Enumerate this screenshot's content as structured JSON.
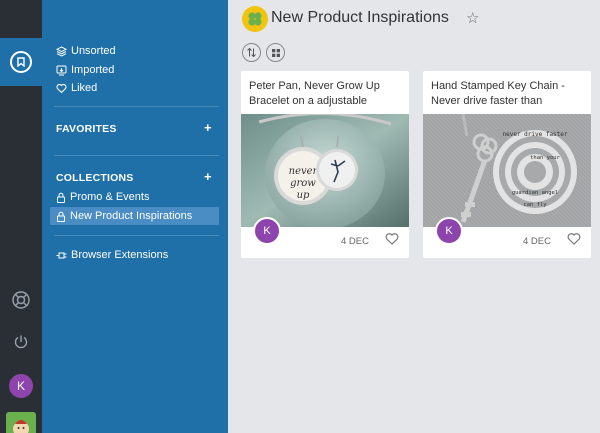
{
  "rail": {
    "avatar_initial": "K"
  },
  "sidebar": {
    "items": [
      {
        "label": "Unsorted",
        "icon": "layers-icon"
      },
      {
        "label": "Imported",
        "icon": "import-icon"
      },
      {
        "label": "Liked",
        "icon": "heart-icon"
      }
    ],
    "favorites_title": "FAVORITES",
    "favorites_add": "+",
    "collections_title": "COLLECTIONS",
    "collections_add": "+",
    "collections": [
      {
        "label": "Promo & Events",
        "icon": "lock-icon"
      },
      {
        "label": "New Product Inspirations",
        "icon": "lock-icon",
        "active": true
      }
    ],
    "extensions_label": "Browser Extensions"
  },
  "main": {
    "title": "New Product Inspirations",
    "star": "☆"
  },
  "cards": [
    {
      "title": "Peter Pan, Never Grow Up Bracelet on a adjustable",
      "image_text": "never grow up",
      "avatar": "K",
      "date": "4 DEC"
    },
    {
      "title": "Hand Stamped Key Chain - Never drive faster than",
      "image_text": "never drive faster than your guardian angel can fly",
      "avatar": "K",
      "date": "4 DEC"
    }
  ],
  "colors": {
    "rail": "#2a2f35",
    "sidebar": "#1f6fa8",
    "active": "#4a8cc4",
    "avatar": "#8e44ad",
    "background": "#e4e6ea"
  }
}
